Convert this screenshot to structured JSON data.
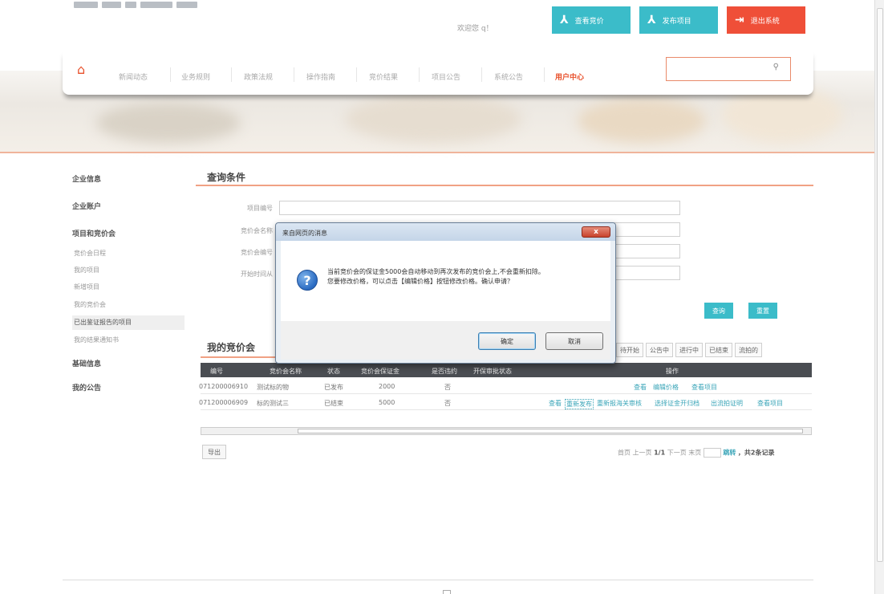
{
  "header": {
    "welcome": "欢迎您 q！",
    "buttons": [
      {
        "label": "查看竞价",
        "icon": "wrench-icon"
      },
      {
        "label": "发布项目",
        "icon": "wrench-icon"
      },
      {
        "label": "退出系统",
        "icon": "exit-icon"
      }
    ]
  },
  "nav": {
    "items": [
      "新闻动态",
      "业务规则",
      "政策法规",
      "操作指南",
      "竞价结果",
      "项目公告",
      "系统公告",
      "用户中心"
    ],
    "active": "用户中心"
  },
  "sidebar": {
    "headings": {
      "company_info": "企业信息",
      "company_account": "企业账户",
      "projects": "项目和竞价会",
      "basic_info": "基础信息",
      "announcements": "我的公告"
    },
    "project_items": [
      "竞价会日程",
      "我的项目",
      "新增项目",
      "我的竞价会",
      "已出鉴证报告的项目",
      "我的结果通知书"
    ],
    "active_item": "我的竞价会"
  },
  "query": {
    "title": "查询条件",
    "fields": [
      "项目编号",
      "竞价会名称",
      "竞价会编号",
      "开始时间从"
    ],
    "search_label": "查询",
    "reset_label": "重置"
  },
  "results": {
    "title": "我的竞价会",
    "tabs": [
      "待开始",
      "公告中",
      "进行中",
      "已结束",
      "流拍的"
    ],
    "columns": [
      "编号",
      "竞价会名称",
      "状态",
      "竞价会保证金",
      "是否违约",
      "开保审批状态",
      "操作"
    ],
    "rows": [
      {
        "id": "071200006910",
        "name": "测试标的物",
        "status": "已发布",
        "deposit": "2000",
        "breach": "否",
        "approval": "",
        "ops": [
          "查看",
          "编辑价格",
          "查看项目"
        ]
      },
      {
        "id": "071200006909",
        "name": "标的测试三",
        "status": "已结束",
        "deposit": "5000",
        "breach": "否",
        "approval": "",
        "ops": [
          "查看",
          "重新发布",
          "重新报海关审核",
          "选择证金开归档",
          "出流拍证明",
          "查看项目"
        ]
      }
    ],
    "export_label": "导出",
    "pager": {
      "nav": "首页 上一页",
      "page": "1/1",
      "next": "下一页 末页",
      "go": "跳转",
      "total": "，共2条记录"
    }
  },
  "dialog": {
    "title": "来自网页的消息",
    "close_label": "x",
    "line1": "当前竞价会的保证金5000会自动移动到再次发布的竞价会上,不会重新扣除。",
    "line2": "您要修改价格，可以点击【编辑价格】按钮修改价格。确认申请？",
    "ok_label": "确定",
    "cancel_label": "取消"
  },
  "colors": {
    "accent_teal": "#3bbcc9",
    "accent_red": "#ef4f38",
    "nav_active": "#e8512c"
  }
}
